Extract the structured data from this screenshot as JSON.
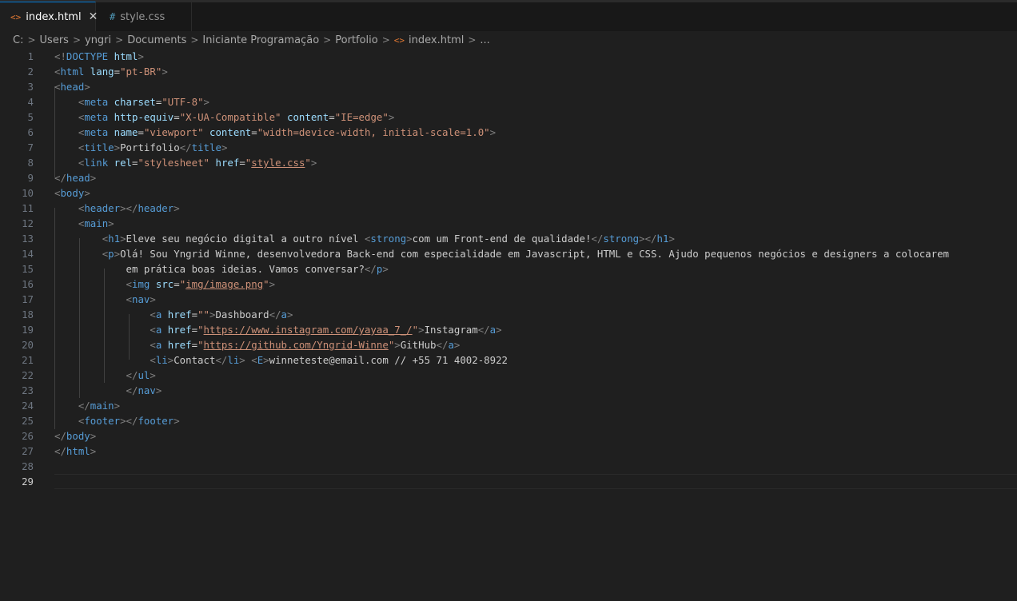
{
  "tabs": [
    {
      "icon": "<>",
      "label": "index.html",
      "close": "✕",
      "active": true
    },
    {
      "icon": "#",
      "label": "style.css",
      "active": false
    }
  ],
  "breadcrumb": [
    "C:",
    "Users",
    "yngri",
    "Documents",
    "Iniciante Programação",
    "Portfolio",
    "index.html",
    "..."
  ],
  "editor": {
    "current_line": 29,
    "lines": [
      [
        [
          "b",
          "<!"
        ],
        [
          "tag",
          "DOCTYPE"
        ],
        [
          "txt",
          " "
        ],
        [
          "attr",
          "html"
        ],
        [
          "b",
          ">"
        ]
      ],
      [
        [
          "b",
          "<"
        ],
        [
          "tag",
          "html"
        ],
        [
          "txt",
          " "
        ],
        [
          "attr",
          "lang"
        ],
        [
          "txt",
          "="
        ],
        [
          "str",
          "\"pt-BR\""
        ],
        [
          "b",
          ">"
        ]
      ],
      [
        [
          "b",
          "<"
        ],
        [
          "tag",
          "head"
        ],
        [
          "b",
          ">"
        ]
      ],
      [
        [
          "txt",
          "    "
        ],
        [
          "b",
          "<"
        ],
        [
          "tag",
          "meta"
        ],
        [
          "txt",
          " "
        ],
        [
          "attr",
          "charset"
        ],
        [
          "txt",
          "="
        ],
        [
          "str",
          "\"UTF-8\""
        ],
        [
          "b",
          ">"
        ]
      ],
      [
        [
          "txt",
          "    "
        ],
        [
          "b",
          "<"
        ],
        [
          "tag",
          "meta"
        ],
        [
          "txt",
          " "
        ],
        [
          "attr",
          "http-equiv"
        ],
        [
          "txt",
          "="
        ],
        [
          "str",
          "\"X-UA-Compatible\""
        ],
        [
          "txt",
          " "
        ],
        [
          "attr",
          "content"
        ],
        [
          "txt",
          "="
        ],
        [
          "str",
          "\"IE=edge\""
        ],
        [
          "b",
          ">"
        ]
      ],
      [
        [
          "txt",
          "    "
        ],
        [
          "b",
          "<"
        ],
        [
          "tag",
          "meta"
        ],
        [
          "txt",
          " "
        ],
        [
          "attr",
          "name"
        ],
        [
          "txt",
          "="
        ],
        [
          "str",
          "\"viewport\""
        ],
        [
          "txt",
          " "
        ],
        [
          "attr",
          "content"
        ],
        [
          "txt",
          "="
        ],
        [
          "str",
          "\"width=device-width, initial-scale=1.0\""
        ],
        [
          "b",
          ">"
        ]
      ],
      [
        [
          "txt",
          "    "
        ],
        [
          "b",
          "<"
        ],
        [
          "tag",
          "title"
        ],
        [
          "b",
          ">"
        ],
        [
          "txt",
          "Portifolio"
        ],
        [
          "b",
          "</"
        ],
        [
          "tag",
          "title"
        ],
        [
          "b",
          ">"
        ]
      ],
      [
        [
          "txt",
          "    "
        ],
        [
          "b",
          "<"
        ],
        [
          "tag",
          "link"
        ],
        [
          "txt",
          " "
        ],
        [
          "attr",
          "rel"
        ],
        [
          "txt",
          "="
        ],
        [
          "str",
          "\"stylesheet\""
        ],
        [
          "txt",
          " "
        ],
        [
          "attr",
          "href"
        ],
        [
          "txt",
          "="
        ],
        [
          "str",
          "\""
        ],
        [
          "link",
          "style.css"
        ],
        [
          "str",
          "\""
        ],
        [
          "b",
          ">"
        ]
      ],
      [
        [
          "b",
          "</"
        ],
        [
          "tag",
          "head"
        ],
        [
          "b",
          ">"
        ]
      ],
      [
        [
          "b",
          "<"
        ],
        [
          "tag",
          "body"
        ],
        [
          "b",
          ">"
        ]
      ],
      [
        [
          "txt",
          "    "
        ],
        [
          "b",
          "<"
        ],
        [
          "tag",
          "header"
        ],
        [
          "b",
          "></"
        ],
        [
          "tag",
          "header"
        ],
        [
          "b",
          ">"
        ]
      ],
      [
        [
          "txt",
          "    "
        ],
        [
          "b",
          "<"
        ],
        [
          "tag",
          "main"
        ],
        [
          "b",
          ">"
        ]
      ],
      [
        [
          "txt",
          "        "
        ],
        [
          "b",
          "<"
        ],
        [
          "tag",
          "h1"
        ],
        [
          "b",
          ">"
        ],
        [
          "txt",
          "Eleve seu negócio digital a outro nível "
        ],
        [
          "b",
          "<"
        ],
        [
          "tag",
          "strong"
        ],
        [
          "b",
          ">"
        ],
        [
          "txt",
          "com um Front-end de qualidade!"
        ],
        [
          "b",
          "</"
        ],
        [
          "tag",
          "strong"
        ],
        [
          "b",
          "></"
        ],
        [
          "tag",
          "h1"
        ],
        [
          "b",
          ">"
        ]
      ],
      [
        [
          "txt",
          "        "
        ],
        [
          "b",
          "<"
        ],
        [
          "tag",
          "p"
        ],
        [
          "b",
          ">"
        ],
        [
          "txt",
          "Olá! Sou Yngrid Winne, desenvolvedora Back-end com especialidade em Javascript, HTML e CSS. Ajudo pequenos negócios e designers a colocarem"
        ]
      ],
      [
        [
          "txt",
          "            em prática boas ideias. Vamos conversar?"
        ],
        [
          "b",
          "</"
        ],
        [
          "tag",
          "p"
        ],
        [
          "b",
          ">"
        ]
      ],
      [
        [
          "txt",
          "            "
        ],
        [
          "b",
          "<"
        ],
        [
          "tag",
          "img"
        ],
        [
          "txt",
          " "
        ],
        [
          "attr",
          "src"
        ],
        [
          "txt",
          "="
        ],
        [
          "str",
          "\""
        ],
        [
          "link",
          "img/image.png"
        ],
        [
          "str",
          "\""
        ],
        [
          "b",
          ">"
        ]
      ],
      [
        [
          "txt",
          "            "
        ],
        [
          "b",
          "<"
        ],
        [
          "tag",
          "nav"
        ],
        [
          "b",
          ">"
        ]
      ],
      [
        [
          "txt",
          "                "
        ],
        [
          "b",
          "<"
        ],
        [
          "tag",
          "a"
        ],
        [
          "txt",
          " "
        ],
        [
          "attr",
          "href"
        ],
        [
          "txt",
          "="
        ],
        [
          "str",
          "\"\""
        ],
        [
          "b",
          ">"
        ],
        [
          "txt",
          "Dashboard"
        ],
        [
          "b",
          "</"
        ],
        [
          "tag",
          "a"
        ],
        [
          "b",
          ">"
        ]
      ],
      [
        [
          "txt",
          "                "
        ],
        [
          "b",
          "<"
        ],
        [
          "tag",
          "a"
        ],
        [
          "txt",
          " "
        ],
        [
          "attr",
          "href"
        ],
        [
          "txt",
          "="
        ],
        [
          "str",
          "\""
        ],
        [
          "link",
          "https://www.instagram.com/yayaa_7_/"
        ],
        [
          "str",
          "\""
        ],
        [
          "b",
          ">"
        ],
        [
          "txt",
          "Instagram"
        ],
        [
          "b",
          "</"
        ],
        [
          "tag",
          "a"
        ],
        [
          "b",
          ">"
        ]
      ],
      [
        [
          "txt",
          "                "
        ],
        [
          "b",
          "<"
        ],
        [
          "tag",
          "a"
        ],
        [
          "txt",
          " "
        ],
        [
          "attr",
          "href"
        ],
        [
          "txt",
          "="
        ],
        [
          "str",
          "\""
        ],
        [
          "link",
          "https://github.com/Yngrid-Winne"
        ],
        [
          "str",
          "\""
        ],
        [
          "b",
          ">"
        ],
        [
          "txt",
          "GitHub"
        ],
        [
          "b",
          "</"
        ],
        [
          "tag",
          "a"
        ],
        [
          "b",
          ">"
        ]
      ],
      [
        [
          "txt",
          "                "
        ],
        [
          "b",
          "<"
        ],
        [
          "tag",
          "li"
        ],
        [
          "b",
          ">"
        ],
        [
          "txt",
          "Contact"
        ],
        [
          "b",
          "</"
        ],
        [
          "tag",
          "li"
        ],
        [
          "b",
          ">"
        ],
        [
          "txt",
          " "
        ],
        [
          "b",
          "<"
        ],
        [
          "tag",
          "E"
        ],
        [
          "b",
          ">"
        ],
        [
          "txt",
          "winneteste@email.com // +55 71 4002-8922"
        ]
      ],
      [
        [
          "txt",
          "            "
        ],
        [
          "b",
          "</"
        ],
        [
          "tag",
          "ul"
        ],
        [
          "b",
          ">"
        ]
      ],
      [
        [
          "txt",
          "            "
        ],
        [
          "b",
          "</"
        ],
        [
          "tag",
          "nav"
        ],
        [
          "b",
          ">"
        ]
      ],
      [
        [
          "txt",
          "    "
        ],
        [
          "b",
          "</"
        ],
        [
          "tag",
          "main"
        ],
        [
          "b",
          ">"
        ]
      ],
      [
        [
          "txt",
          "    "
        ],
        [
          "b",
          "<"
        ],
        [
          "tag",
          "footer"
        ],
        [
          "b",
          "></"
        ],
        [
          "tag",
          "footer"
        ],
        [
          "b",
          ">"
        ]
      ],
      [
        [
          "b",
          "</"
        ],
        [
          "tag",
          "body"
        ],
        [
          "b",
          ">"
        ]
      ],
      [
        [
          "b",
          "</"
        ],
        [
          "tag",
          "html"
        ],
        [
          "b",
          ">"
        ]
      ],
      [],
      []
    ]
  }
}
